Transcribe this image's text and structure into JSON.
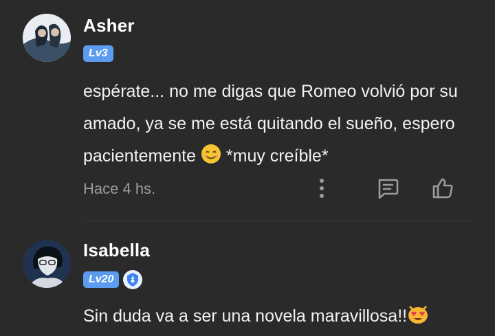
{
  "comments": [
    {
      "username": "Asher",
      "level": "Lv3",
      "text": "espérate... no me digas que Romeo volvió por su amado, ya se me está quitando el sueño, espero pacientemente 😊 *muy creíble*",
      "text_before_emoji": "espérate... no me digas que Romeo volvió por su amado, ya se me está quitando el sueño, espero pacientemente ",
      "text_after_emoji": " *muy creíble*",
      "timestamp": "Hace 4 hs."
    },
    {
      "username": "Isabella",
      "level": "Lv20",
      "text": "Sin duda va a ser una novela maravillosa!!😻",
      "text_before_emoji": "Sin duda va a ser una novela maravillosa!!"
    }
  ],
  "icons": {
    "more": "more-vertical-icon",
    "reply": "comment-reply-icon",
    "like": "thumbs-up-icon",
    "rank": "rank-shield-icon"
  },
  "colors": {
    "background": "#2a2a2b",
    "level_badge": "#5b9cf0",
    "muted_text": "#9c9c9c"
  }
}
